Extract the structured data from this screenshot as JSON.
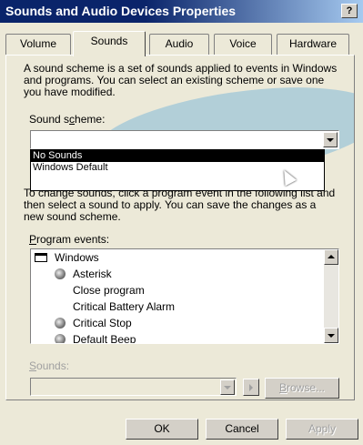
{
  "window": {
    "title": "Sounds and Audio Devices Properties",
    "help_label": "?"
  },
  "tabs": [
    {
      "label": "Volume",
      "active": false
    },
    {
      "label": "Sounds",
      "active": true
    },
    {
      "label": "Audio",
      "active": false
    },
    {
      "label": "Voice",
      "active": false
    },
    {
      "label": "Hardware",
      "active": false
    }
  ],
  "sounds_tab": {
    "intro": "A sound scheme is a set of sounds applied to events in Windows and programs. You can select an existing scheme or save one you have modified.",
    "scheme_label_pre": "Sound s",
    "scheme_label_u": "c",
    "scheme_label_post": "heme:",
    "scheme_value": "",
    "scheme_options": [
      "No Sounds",
      "Windows Default"
    ],
    "scheme_selected_index": 0,
    "instructions": "To change sounds, click a program event in the following list and then select a sound to apply. You can save the changes as a new sound scheme.",
    "program_events_label_u": "P",
    "program_events_label_rest": "rogram events:",
    "events": [
      {
        "label": "Windows",
        "icon": "window-icon",
        "indent": 0
      },
      {
        "label": "Asterisk",
        "icon": "speaker-icon",
        "indent": 1
      },
      {
        "label": "Close program",
        "icon": "",
        "indent": 1
      },
      {
        "label": "Critical Battery Alarm",
        "icon": "",
        "indent": 1
      },
      {
        "label": "Critical Stop",
        "icon": "speaker-icon",
        "indent": 1
      },
      {
        "label": "Default Beep",
        "icon": "speaker-icon",
        "indent": 1
      }
    ],
    "sounds_label_u": "S",
    "sounds_label_rest": "ounds:",
    "sounds_value": "",
    "browse_u": "B",
    "browse_rest": "rowse..."
  },
  "buttons": {
    "ok": "OK",
    "cancel": "Cancel",
    "apply": "Apply"
  }
}
